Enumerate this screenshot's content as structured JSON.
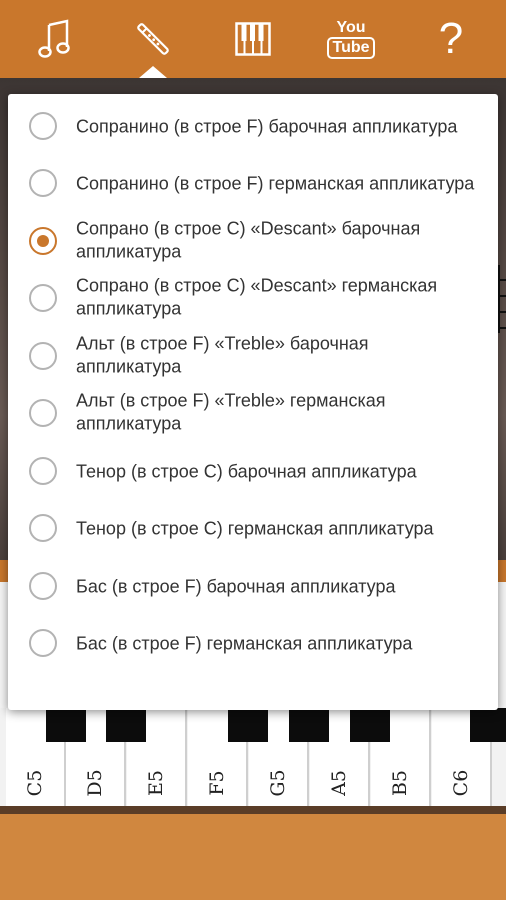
{
  "toolbar": {
    "tabs": [
      {
        "icon": "music-note-icon",
        "active": false
      },
      {
        "icon": "recorder-icon",
        "active": true
      },
      {
        "icon": "piano-icon",
        "active": false
      },
      {
        "icon": "youtube-icon",
        "label_top": "You",
        "label_bottom": "Tube",
        "active": false
      },
      {
        "icon": "help-icon",
        "label": "?",
        "active": false
      }
    ]
  },
  "colors": {
    "accent": "#c9772c",
    "bottom_bar": "#d0873f",
    "text": "#333333"
  },
  "dialog": {
    "options": [
      {
        "label": "Сопранино (в строе F) барочная аппликатура",
        "checked": false
      },
      {
        "label": "Сопранино (в строе F) германская аппликатура",
        "checked": false
      },
      {
        "label": "Сопрано (в строе C) «Descant» барочная аппликатура",
        "checked": true
      },
      {
        "label": "Сопрано (в строе C) «Descant» германская аппликатура",
        "checked": false
      },
      {
        "label": "Альт (в строе F) «Treble» барочная аппликатура",
        "checked": false
      },
      {
        "label": "Альт (в строе F) «Treble» германская аппликатура",
        "checked": false
      },
      {
        "label": "Тенор (в строе C) барочная аппликатура",
        "checked": false
      },
      {
        "label": "Тенор (в строе C) германская аппликатура",
        "checked": false
      },
      {
        "label": "Бас (в строе F) барочная аппликатура",
        "checked": false
      },
      {
        "label": "Бас (в строе F) германская аппликатура",
        "checked": false
      }
    ]
  },
  "keyboard": {
    "white_keys": [
      "C5",
      "D5",
      "E5",
      "F5",
      "G5",
      "A5",
      "B5",
      "C6"
    ]
  }
}
